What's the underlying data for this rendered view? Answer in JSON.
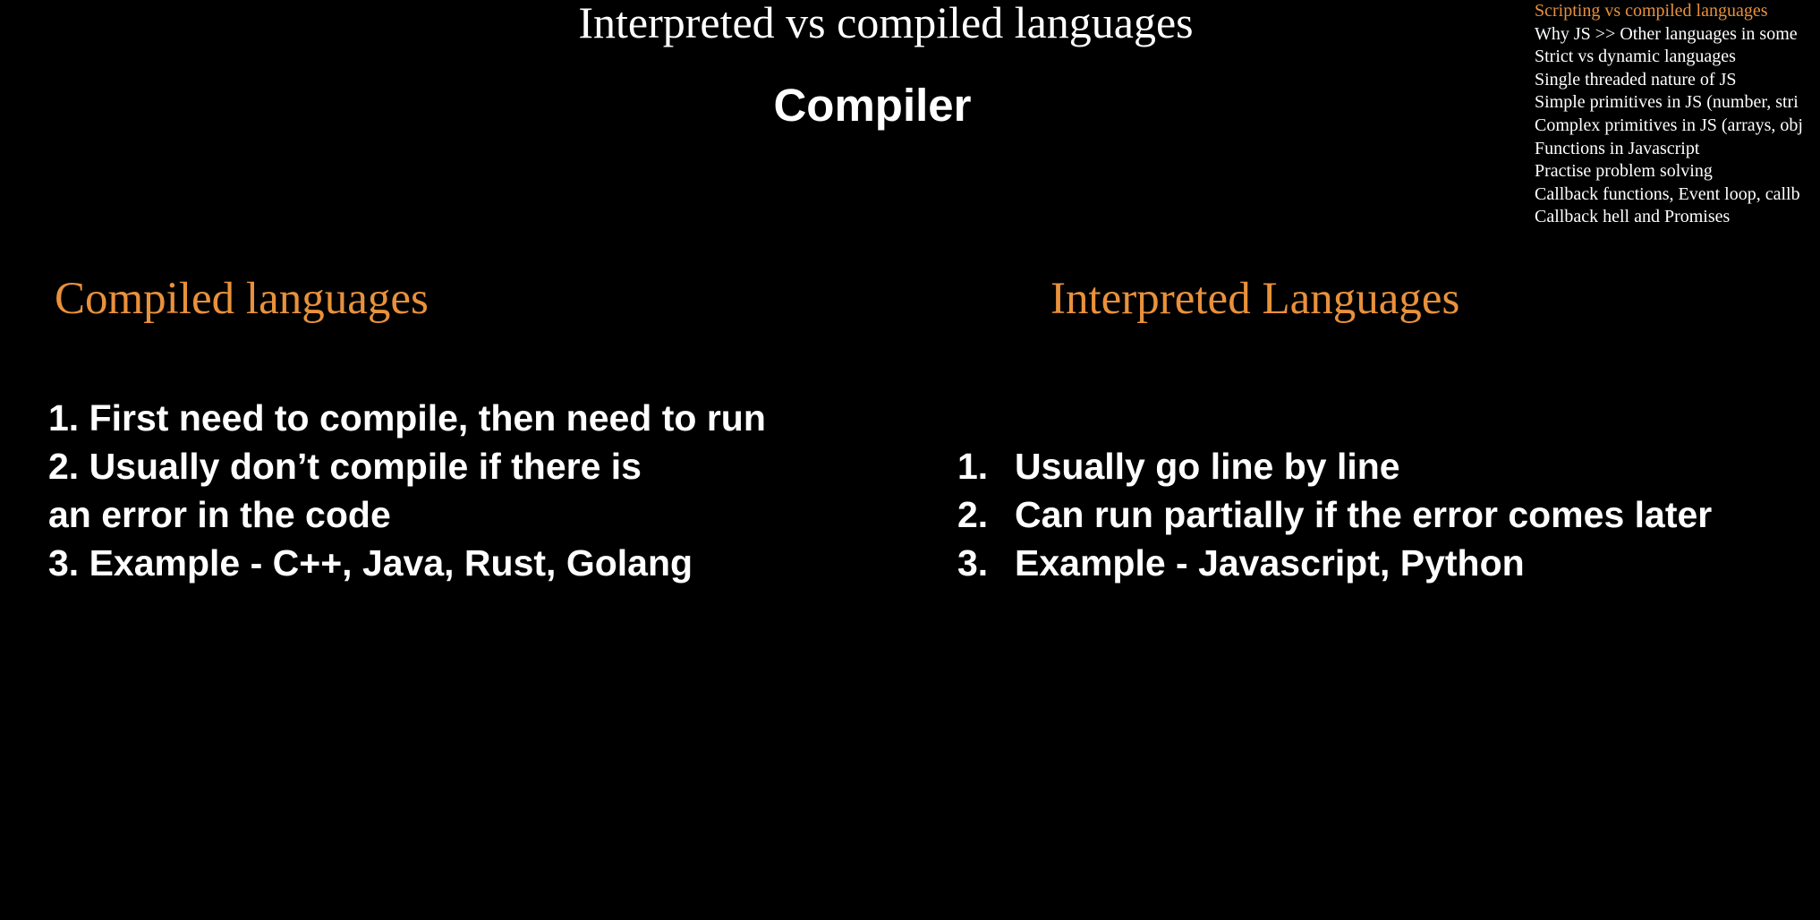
{
  "slide": {
    "title": "Interpreted vs compiled languages",
    "subtitle": "Compiler"
  },
  "toc": {
    "items": [
      {
        "label": "Scripting vs compiled languages",
        "active": true
      },
      {
        "label": "Why JS >> Other languages in some"
      },
      {
        "label": "Strict vs dynamic languages"
      },
      {
        "label": "Single threaded nature of JS"
      },
      {
        "label": "Simple primitives in JS (number, stri"
      },
      {
        "label": "Complex primitives in JS (arrays, obj"
      },
      {
        "label": "Functions in Javascript"
      },
      {
        "label": "Practise problem solving"
      },
      {
        "label": "Callback functions, Event loop, callb"
      },
      {
        "label": "Callback hell and Promises"
      }
    ]
  },
  "compiled": {
    "heading": "Compiled languages",
    "lines": [
      "1. First need to compile, then need to run",
      "2. Usually don’t compile if there is",
      "an error in the code",
      "3. Example - C++, Java, Rust, Golang"
    ]
  },
  "interpreted": {
    "heading": "Interpreted Languages",
    "items": [
      {
        "num": "1.",
        "text": "Usually go line by line"
      },
      {
        "num": "2.",
        "text": "Can run partially if the error comes later"
      },
      {
        "num": "3.",
        "text": "Example - Javascript, Python"
      }
    ]
  },
  "colors": {
    "background": "#000000",
    "text": "#ffffff",
    "accent": "#e8913c"
  }
}
